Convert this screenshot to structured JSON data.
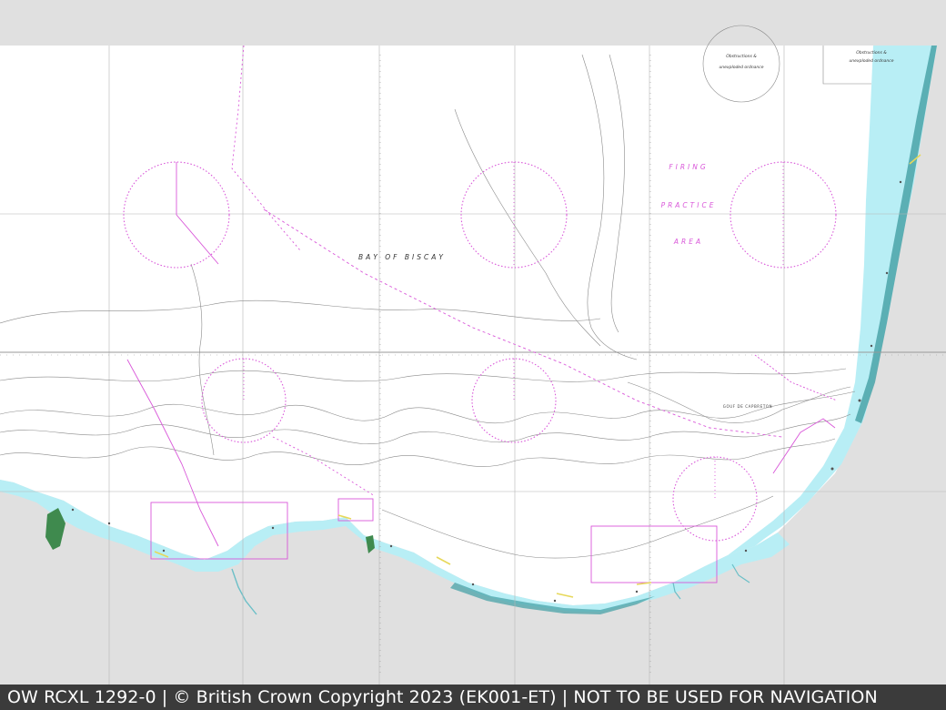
{
  "chart": {
    "sea_name": "BAY OF BISCAY",
    "firing_area_lines": [
      "FIRING",
      "PRACTICE",
      "AREA"
    ],
    "obstructions_labels": [
      "Obstructions &",
      "unexploded ordnance"
    ],
    "gulf_label": "GOUF DE CAPBRETON"
  },
  "colors": {
    "land_background": "#e0e0e0",
    "sea_deep": "#ffffff",
    "sea_shallow": "#b8eef5",
    "sea_very_shallow": "#8fd3dd",
    "sea_intertidal": "#4aa3a8",
    "land_green": "#3f8a4e",
    "magenta": "#d957d9",
    "grid": "#b5b5b5",
    "contour": "#8a8a8a",
    "footer_bg": "#3b3b3b",
    "footer_text": "#ffffff"
  },
  "footer": {
    "text": "OW RCXL 1292-0 | © British Crown Copyright 2023 (EK001-ET) | NOT TO BE USED FOR NAVIGATION"
  }
}
